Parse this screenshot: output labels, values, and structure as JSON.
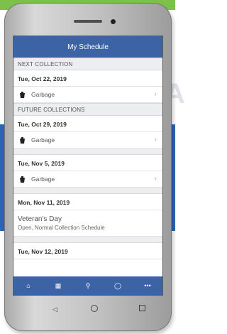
{
  "app": {
    "title": "My Schedule"
  },
  "background": {
    "glyph": "A"
  },
  "sections": {
    "next": {
      "header": "NEXT COLLECTION",
      "date": "Tue, Oct 22, 2019",
      "item": {
        "icon": "trash-icon",
        "label": "Garbage"
      }
    },
    "future": {
      "header": "FUTURE COLLECTIONS",
      "entries": [
        {
          "date": "Tue, Oct 29, 2019",
          "item": {
            "icon": "trash-icon",
            "label": "Garbage"
          }
        },
        {
          "date": "Tue, Nov 5, 2019",
          "item": {
            "icon": "trash-icon",
            "label": "Garbage"
          }
        }
      ],
      "event": {
        "date": "Mon, Nov 11, 2019",
        "title": "Veteran's Day",
        "subtitle": "Open, Normal Collection Schedule"
      },
      "last_date": "Tue, Nov 12, 2019"
    }
  },
  "tabbar": {
    "items": [
      {
        "icon": "home-icon",
        "glyph": "⌂"
      },
      {
        "icon": "calendar-icon",
        "glyph": "▦"
      },
      {
        "icon": "search-icon",
        "glyph": "⚲"
      },
      {
        "icon": "chat-icon",
        "glyph": "◯"
      },
      {
        "icon": "more-icon",
        "glyph": "•••"
      }
    ]
  },
  "colors": {
    "header_bg": "#3c64a4",
    "background_blue": "#2a66b8",
    "background_green": "#7cc24a"
  }
}
